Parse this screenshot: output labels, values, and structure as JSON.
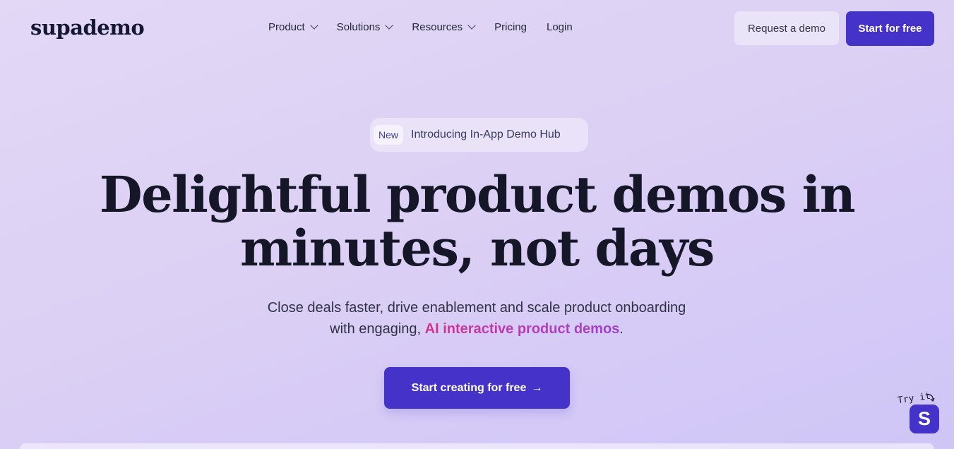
{
  "nav": {
    "logo": "supademo",
    "menu": [
      {
        "label": "Product",
        "has_dropdown": true
      },
      {
        "label": "Solutions",
        "has_dropdown": true
      },
      {
        "label": "Resources",
        "has_dropdown": true
      },
      {
        "label": "Pricing",
        "has_dropdown": false
      },
      {
        "label": "Login",
        "has_dropdown": false
      }
    ],
    "request_demo": "Request a demo",
    "start_free": "Start for free"
  },
  "announcement": {
    "tag": "New",
    "text": "Introducing In-App Demo Hub"
  },
  "hero": {
    "headline_line1": "Delightful product demos in",
    "headline_line2": "minutes, not days",
    "subtitle_part1": "Close deals faster, drive enablement and scale product onboarding",
    "subtitle_part2": "with engaging,",
    "subtitle_highlight": "AI interactive product demos",
    "subtitle_end": ".",
    "cta_label": "Start creating for free",
    "cta_arrow": "→"
  },
  "widget": {
    "label": "Try it",
    "button_letter": "S"
  },
  "colors": {
    "accent": "#4532c8",
    "highlight_start": "#d0358a",
    "highlight_end": "#9b42c8",
    "text_dark": "#151729"
  }
}
